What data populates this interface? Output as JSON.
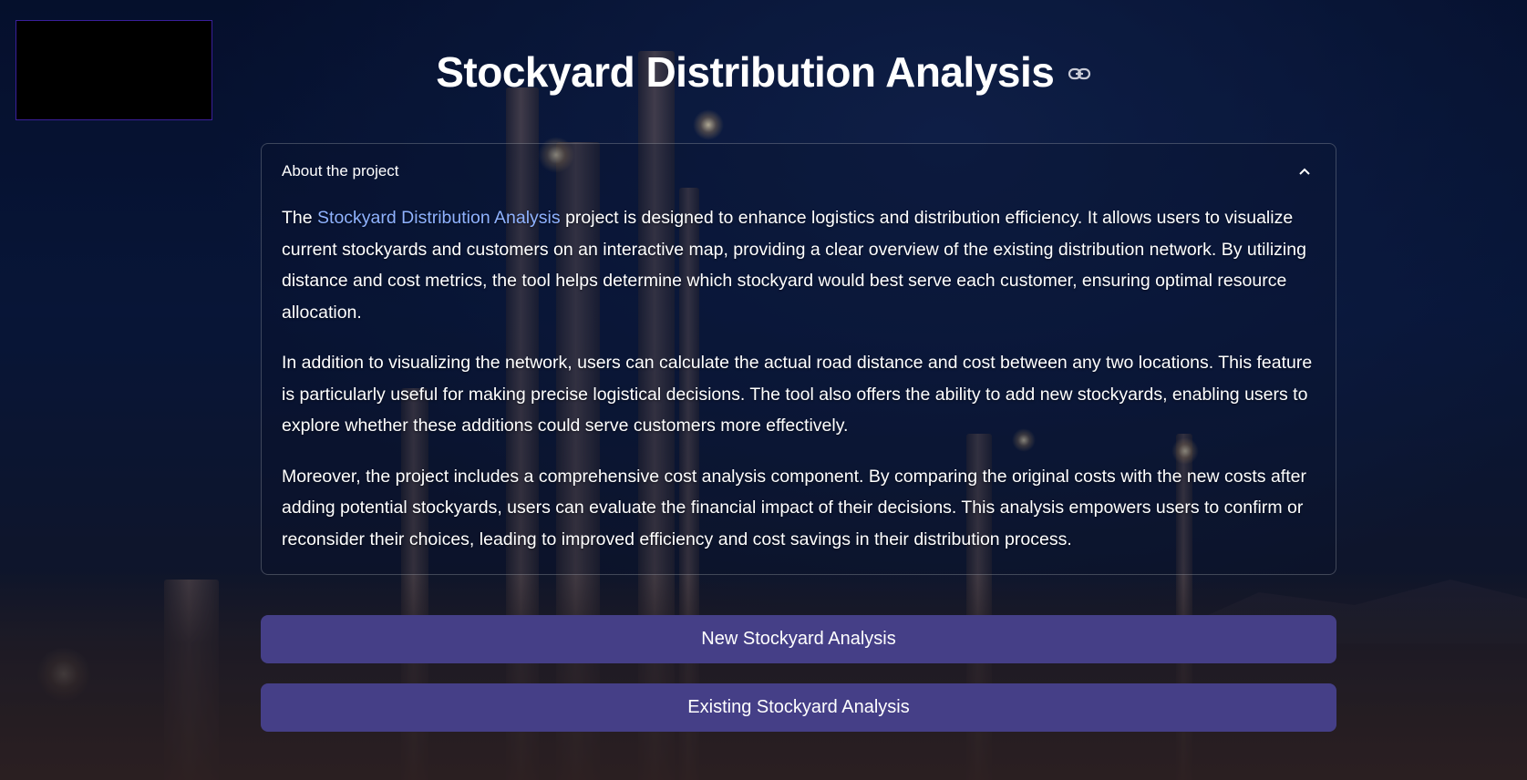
{
  "header": {
    "title": "Stockyard Distribution Analysis",
    "link_icon": "link-icon"
  },
  "expander": {
    "label": "About the project",
    "expanded": true,
    "chevron_icon": "chevron-up-icon",
    "paragraphs": [
      {
        "prefix": "The ",
        "link": "Stockyard Distribution Analysis",
        "suffix": " project is designed to enhance logistics and distribution efficiency. It allows users to visualize current stockyards and customers on an interactive map, providing a clear overview of the existing distribution network. By utilizing distance and cost metrics, the tool helps determine which stockyard would best serve each customer, ensuring optimal resource allocation."
      },
      {
        "text": "In addition to visualizing the network, users can calculate the actual road distance and cost between any two locations. This feature is particularly useful for making precise logistical decisions. The tool also offers the ability to add new stockyards, enabling users to explore whether these additions could serve customers more effectively."
      },
      {
        "text": "Moreover, the project includes a comprehensive cost analysis component. By comparing the original costs with the new costs after adding potential stockyards, users can evaluate the financial impact of their decisions. This analysis empowers users to confirm or reconsider their choices, leading to improved efficiency and cost savings in their distribution process."
      }
    ]
  },
  "buttons": {
    "new_label": "New Stockyard Analysis",
    "existing_label": "Existing Stockyard Analysis"
  },
  "colors": {
    "button_bg": "#453f87",
    "link": "#8fb2ff",
    "logo_border": "#3a1f9a"
  }
}
